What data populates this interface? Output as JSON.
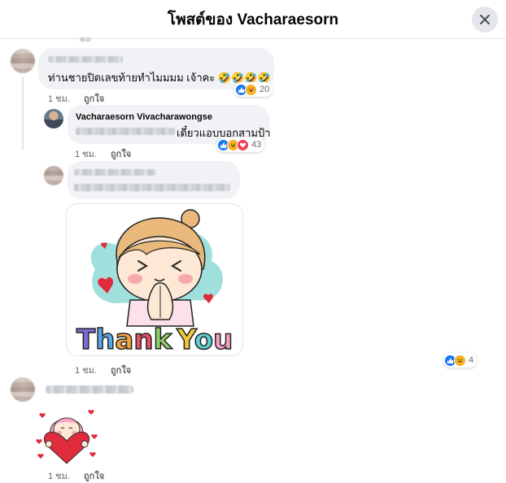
{
  "header": {
    "title": "โพสต์ของ Vacharaesorn"
  },
  "comments": [
    {
      "text": "ท่านชายปิดเลขท้ายทำไมมมม เจ้าคะ 🤣🤣🤣🤣",
      "meta": {
        "time": "1 ชม.",
        "like": "ถูกใจ"
      },
      "reactions": {
        "count": "20"
      }
    },
    {
      "author": "Vacharaesorn Vivacharawongse",
      "text": "เดี๋ยวแอบบอกสามป้า",
      "meta": {
        "time": "1 ชม.",
        "like": "ถูกใจ"
      },
      "reactions": {
        "count": "43"
      }
    },
    {
      "sticker_text": "Thank You",
      "meta": {
        "time": "1 ชม.",
        "like": "ถูกใจ"
      },
      "reactions": {
        "count": "4"
      }
    },
    {
      "meta": {
        "time": "1 ชม.",
        "like": "ถูกใจ"
      }
    }
  ],
  "icons": {
    "close": "close-icon",
    "like": "like-reaction-icon",
    "haha": "haha-reaction-icon",
    "love": "love-reaction-icon"
  },
  "colors": {
    "like": "#1877f2",
    "haha": "#f7b125",
    "love": "#f33e58",
    "bubble": "#f0f2f5",
    "meta": "#65676b"
  }
}
